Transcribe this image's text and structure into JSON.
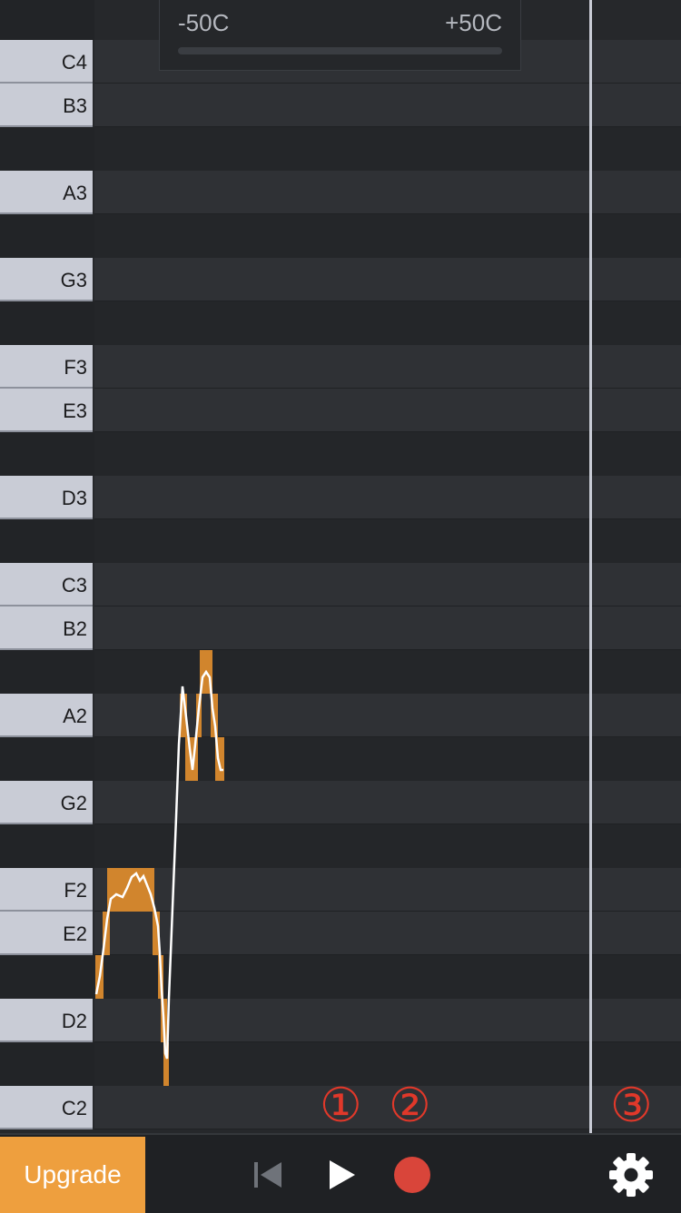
{
  "cents_meter": {
    "min_label": "-50C",
    "max_label": "+50C"
  },
  "piano_rows": [
    {
      "label": "C4",
      "type": "white"
    },
    {
      "label": "B3",
      "type": "white"
    },
    {
      "label": "",
      "type": "black"
    },
    {
      "label": "A3",
      "type": "white"
    },
    {
      "label": "",
      "type": "black"
    },
    {
      "label": "G3",
      "type": "white"
    },
    {
      "label": "",
      "type": "black"
    },
    {
      "label": "F3",
      "type": "white"
    },
    {
      "label": "E3",
      "type": "white"
    },
    {
      "label": "",
      "type": "black"
    },
    {
      "label": "D3",
      "type": "white"
    },
    {
      "label": "",
      "type": "black"
    },
    {
      "label": "C3",
      "type": "white"
    },
    {
      "label": "B2",
      "type": "white"
    },
    {
      "label": "",
      "type": "black"
    },
    {
      "label": "A2",
      "type": "white"
    },
    {
      "label": "",
      "type": "black"
    },
    {
      "label": "G2",
      "type": "white"
    },
    {
      "label": "",
      "type": "black"
    },
    {
      "label": "F2",
      "type": "white"
    },
    {
      "label": "E2",
      "type": "white"
    },
    {
      "label": "",
      "type": "black"
    },
    {
      "label": "D2",
      "type": "white"
    },
    {
      "label": "",
      "type": "black"
    },
    {
      "label": "C2",
      "type": "white"
    }
  ],
  "annotations": {
    "marker_1": "①",
    "marker_2": "②",
    "marker_3": "③"
  },
  "toolbar": {
    "upgrade_label": "Upgrade",
    "rewind_icon": "skip-to-start-icon",
    "play_icon": "play-icon",
    "record_icon": "record-icon",
    "settings_icon": "gear-icon"
  },
  "colors": {
    "note_fill": "#d1852d",
    "pitch_line": "#ffffff",
    "record": "#d9453a",
    "upgrade_bg": "#ee9f3e",
    "marker": "#e0382a"
  }
}
